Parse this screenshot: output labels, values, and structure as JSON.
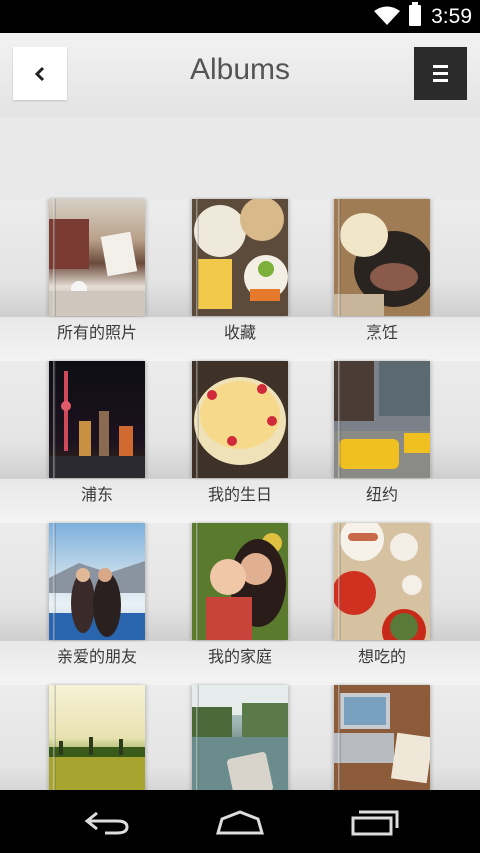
{
  "status_bar": {
    "time": "3:59",
    "icons": [
      "wifi-icon",
      "battery-icon"
    ]
  },
  "header": {
    "title": "Albums",
    "back_icon": "chevron-left-icon",
    "menu_icon": "menu-icon"
  },
  "albums": [
    {
      "label": "所有的照片"
    },
    {
      "label": "收藏"
    },
    {
      "label": "烹饪"
    },
    {
      "label": "浦东"
    },
    {
      "label": "我的生日"
    },
    {
      "label": "纽约"
    },
    {
      "label": "亲爱的朋友"
    },
    {
      "label": "我的家庭"
    },
    {
      "label": "想吃的"
    },
    {
      "label": ""
    },
    {
      "label": ""
    },
    {
      "label": ""
    }
  ],
  "nav_bar": {
    "icons": [
      "back-nav-icon",
      "home-nav-icon",
      "recents-nav-icon"
    ]
  }
}
